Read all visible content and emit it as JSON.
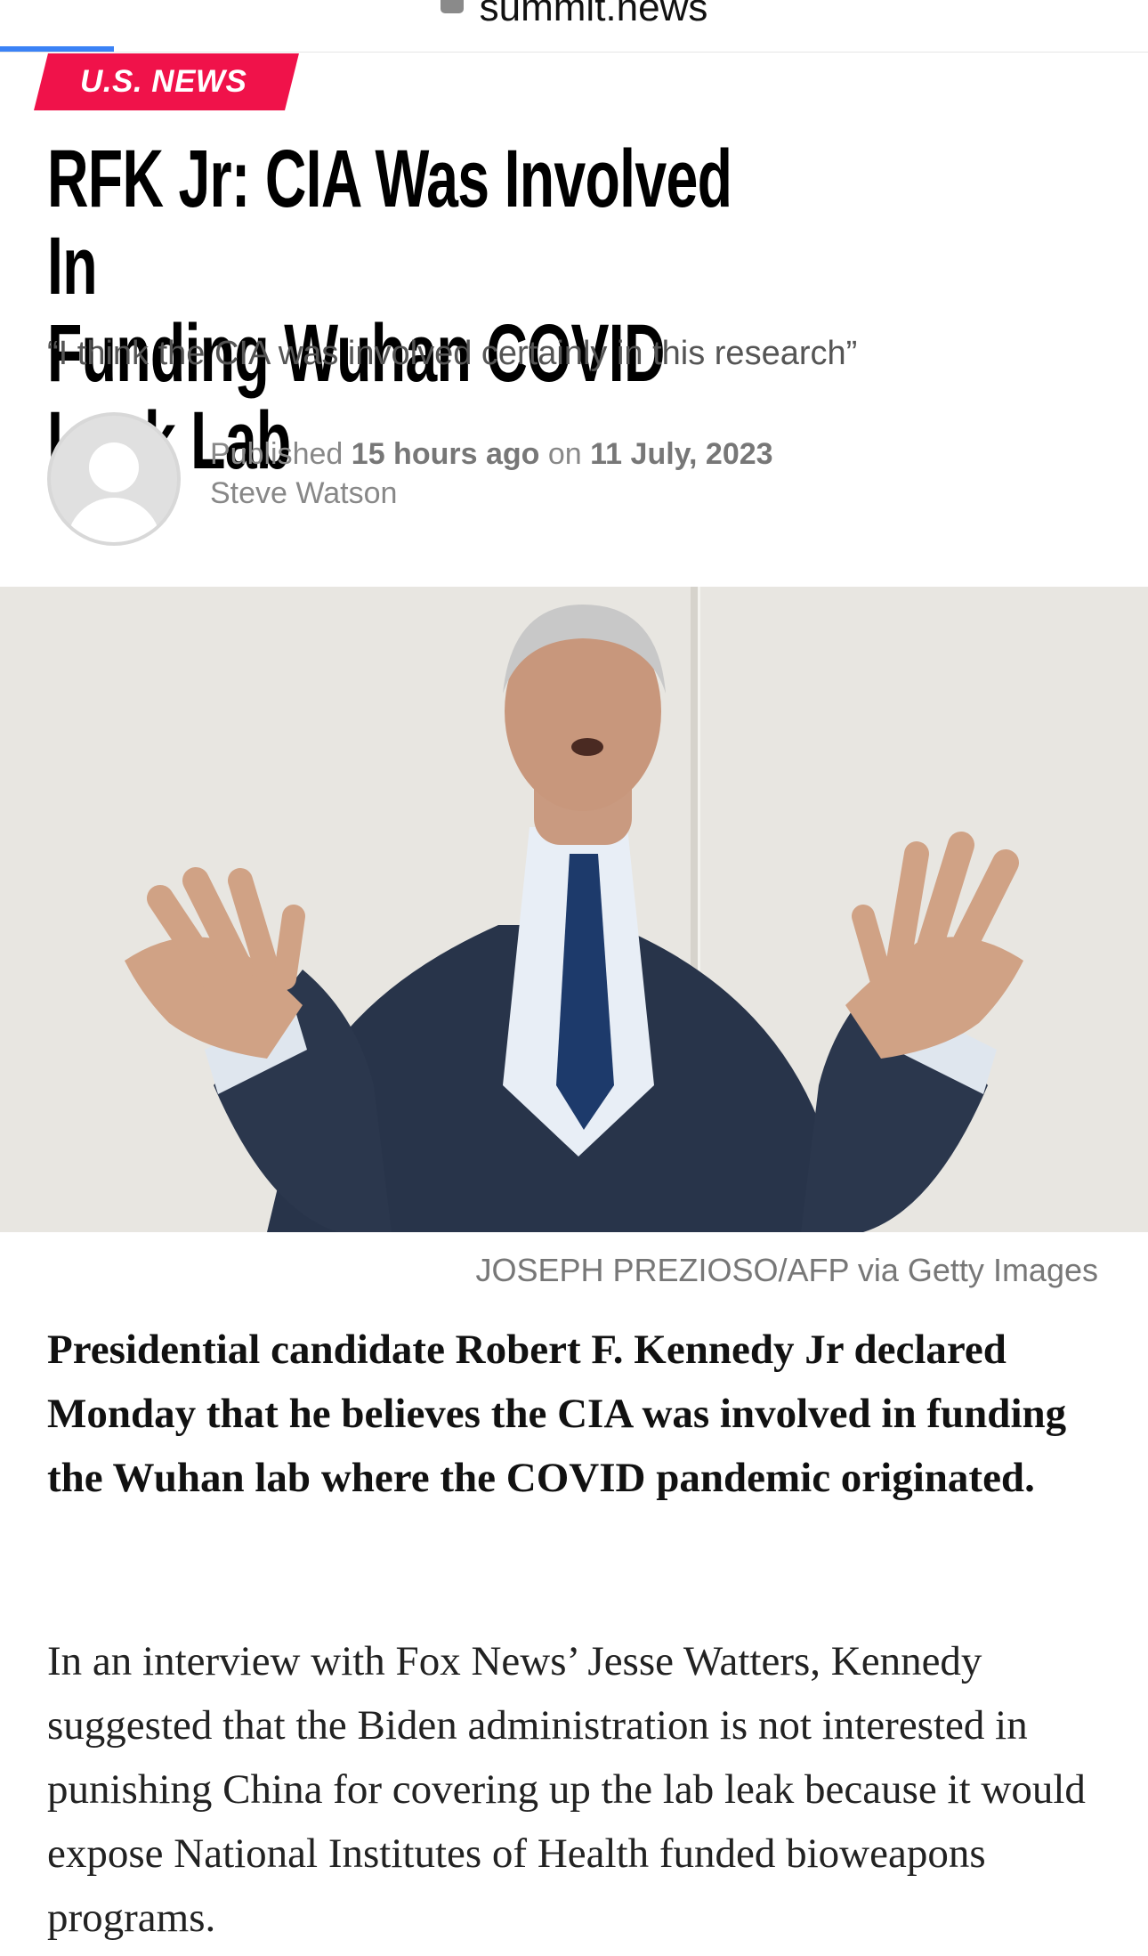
{
  "browser": {
    "url": "summit.news",
    "lock_icon": "lock-icon",
    "loading_color": "#3b82f6"
  },
  "article": {
    "category": "U.S. NEWS",
    "category_color": "#f0124a",
    "title_line1": "RFK Jr: CIA Was Involved In",
    "title_line2": "Funding Wuhan COVID Leak Lab",
    "subtitle": "“I think the CIA was involved certainly in this research”",
    "published_label": "Published",
    "published_relative": "15 hours ago",
    "published_on": "on",
    "published_date": "11 July, 2023",
    "author": "Steve Watson",
    "image_caption": "JOSEPH PREZIOSO/AFP via Getty Images",
    "lead": "Presidential candidate Robert F. Kennedy Jr declared Monday that he believes the CIA was involved in funding the Wuhan lab where the COVID pandemic originated.",
    "body": "In an interview with Fox News’ Jesse Watters, Kennedy suggested that the Biden administration is not interested in punishing China for covering up the lab leak because it would expose National Institutes of Health funded bioweapons programs."
  }
}
